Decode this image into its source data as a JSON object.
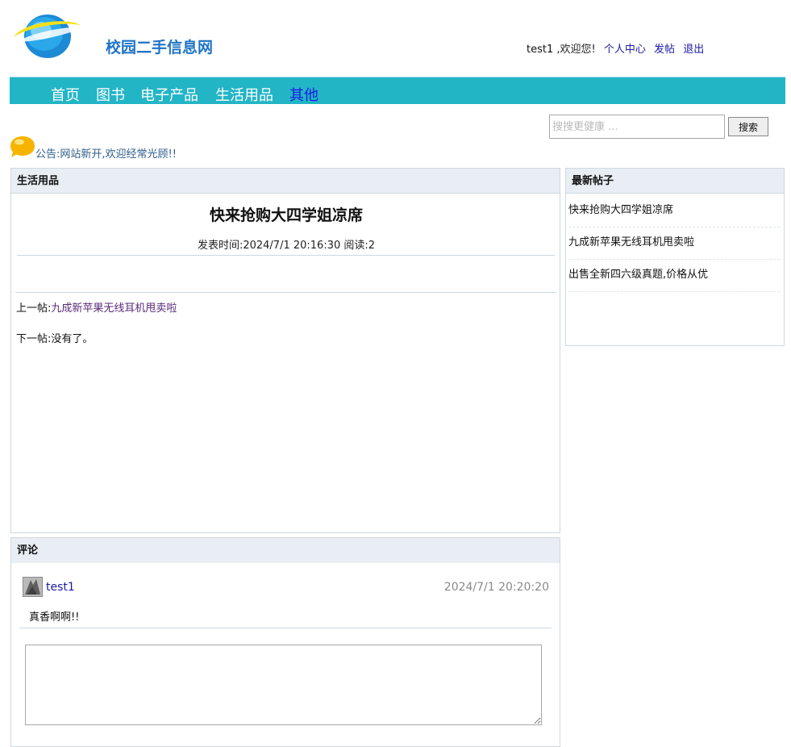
{
  "site": {
    "name": "校园二手信息网"
  },
  "user_bar": {
    "username": "test1",
    "welcome": " ,欢迎您!",
    "links": [
      "个人中心",
      "发帖",
      "退出"
    ]
  },
  "nav": {
    "items": [
      "首页",
      "图书",
      "电子产品",
      "生活用品",
      "其他"
    ],
    "active_index": 4
  },
  "search": {
    "placeholder": "搜搜更健康 ...",
    "button_label": "搜索"
  },
  "notice": {
    "text": "公告:网站新开,欢迎经常光顾!!"
  },
  "main_panel": {
    "header": "生活用品",
    "post_title": "快来抢购大四学姐凉席",
    "meta": "发表时间:2024/7/1 20:16:30 阅读:2",
    "prev_label": "上一帖:",
    "prev_link": "九成新苹果无线耳机甩卖啦",
    "next_label": "下一帖:",
    "next_text": "没有了。"
  },
  "side_panel": {
    "header": "最新帖子",
    "items": [
      "快来抢购大四学姐凉席",
      "九成新苹果无线耳机甩卖啦",
      "出售全新四六级真题,价格从优"
    ]
  },
  "comments": {
    "header": "评论",
    "items": [
      {
        "user": "test1",
        "time": "2024/7/1 20:20:20",
        "text": "真香啊啊!!"
      }
    ]
  },
  "colors": {
    "nav_bg": "#22b5c6",
    "nav_active": "#1a1ae0",
    "link": "#1a1aa6",
    "panel_header_bg": "#e8eef3"
  }
}
